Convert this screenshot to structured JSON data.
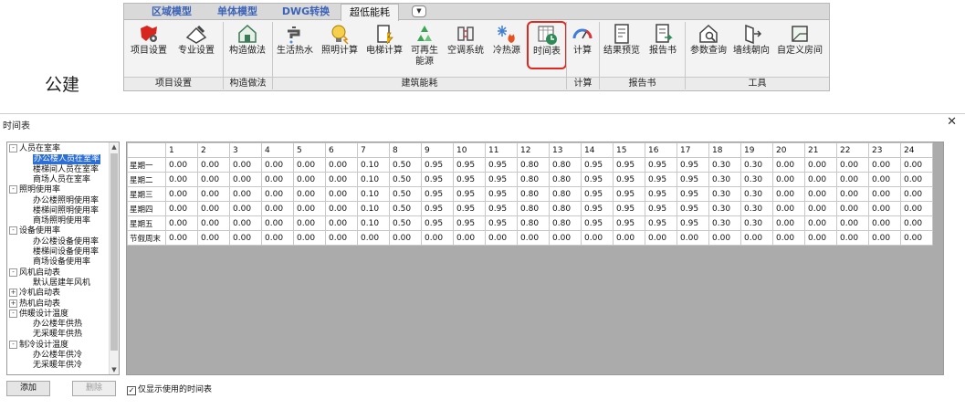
{
  "ribbon": {
    "tabs": [
      {
        "label": "区域模型",
        "active": false
      },
      {
        "label": "单体模型",
        "active": false
      },
      {
        "label": "DWG转换",
        "active": false
      },
      {
        "label": "超低能耗",
        "active": true
      }
    ],
    "tools": [
      {
        "label": "项目设置",
        "icon": "project-settings-icon"
      },
      {
        "label": "专业设置",
        "icon": "professional-settings-icon"
      },
      {
        "label": "构造做法",
        "icon": "house-construction-icon"
      },
      {
        "label": "生活热水",
        "icon": "hot-water-faucet-icon"
      },
      {
        "label": "照明计算",
        "icon": "lightbulb-icon"
      },
      {
        "label": "电梯计算",
        "icon": "elevator-icon"
      },
      {
        "label": "可再生\n能源",
        "icon": "recycle-icon"
      },
      {
        "label": "空调系统",
        "icon": "air-conditioning-icon"
      },
      {
        "label": "冷热源",
        "icon": "snow-flame-icon"
      },
      {
        "label": "时间表",
        "icon": "schedule-clock-icon"
      },
      {
        "label": "计算",
        "icon": "gauge-icon"
      },
      {
        "label": "结果预览",
        "icon": "result-preview-icon"
      },
      {
        "label": "报告书",
        "icon": "report-icon"
      },
      {
        "label": "参数查询",
        "icon": "parameter-query-icon"
      },
      {
        "label": "墙线朝向",
        "icon": "wall-orientation-icon"
      },
      {
        "label": "自定义房间",
        "icon": "custom-room-icon"
      }
    ],
    "groups": [
      "项目设置",
      "构造做法",
      "建筑能耗",
      "计算",
      "报告书",
      "工具"
    ]
  },
  "side_label": "公建",
  "dialog": {
    "title": "时间表",
    "tree": [
      {
        "label": "人员在室率",
        "level": 0,
        "expander": "-"
      },
      {
        "label": "办公楼人员在室率",
        "level": 1,
        "selected": true
      },
      {
        "label": "楼梯间人员在室率",
        "level": 1
      },
      {
        "label": "商场人员在室率",
        "level": 1
      },
      {
        "label": "照明使用率",
        "level": 0,
        "expander": "-"
      },
      {
        "label": "办公楼照明使用率",
        "level": 1
      },
      {
        "label": "楼梯间照明使用率",
        "level": 1
      },
      {
        "label": "商场照明使用率",
        "level": 1
      },
      {
        "label": "设备使用率",
        "level": 0,
        "expander": "-"
      },
      {
        "label": "办公楼设备使用率",
        "level": 1
      },
      {
        "label": "楼梯间设备使用率",
        "level": 1
      },
      {
        "label": "商场设备使用率",
        "level": 1
      },
      {
        "label": "风机启动表",
        "level": 0,
        "expander": "-"
      },
      {
        "label": "默认居建年风机",
        "level": 1
      },
      {
        "label": "冷机启动表",
        "level": 0,
        "expander": "+"
      },
      {
        "label": "热机启动表",
        "level": 0,
        "expander": "+"
      },
      {
        "label": "供暖设计温度",
        "level": 0,
        "expander": "-"
      },
      {
        "label": "办公楼年供热",
        "level": 1
      },
      {
        "label": "无采暖年供热",
        "level": 1
      },
      {
        "label": "制冷设计温度",
        "level": 0,
        "expander": "-"
      },
      {
        "label": "办公楼年供冷",
        "level": 1
      },
      {
        "label": "无采暖年供冷",
        "level": 1
      }
    ],
    "hours": [
      "1",
      "2",
      "3",
      "4",
      "5",
      "6",
      "7",
      "8",
      "9",
      "10",
      "11",
      "12",
      "13",
      "14",
      "15",
      "16",
      "17",
      "18",
      "19",
      "20",
      "21",
      "22",
      "23",
      "24"
    ],
    "rows": [
      {
        "label": "星期一",
        "values": [
          "0.00",
          "0.00",
          "0.00",
          "0.00",
          "0.00",
          "0.00",
          "0.10",
          "0.50",
          "0.95",
          "0.95",
          "0.95",
          "0.80",
          "0.80",
          "0.95",
          "0.95",
          "0.95",
          "0.95",
          "0.30",
          "0.30",
          "0.00",
          "0.00",
          "0.00",
          "0.00",
          "0.00"
        ]
      },
      {
        "label": "星期二",
        "values": [
          "0.00",
          "0.00",
          "0.00",
          "0.00",
          "0.00",
          "0.00",
          "0.10",
          "0.50",
          "0.95",
          "0.95",
          "0.95",
          "0.80",
          "0.80",
          "0.95",
          "0.95",
          "0.95",
          "0.95",
          "0.30",
          "0.30",
          "0.00",
          "0.00",
          "0.00",
          "0.00",
          "0.00"
        ]
      },
      {
        "label": "星期三",
        "values": [
          "0.00",
          "0.00",
          "0.00",
          "0.00",
          "0.00",
          "0.00",
          "0.10",
          "0.50",
          "0.95",
          "0.95",
          "0.95",
          "0.80",
          "0.80",
          "0.95",
          "0.95",
          "0.95",
          "0.95",
          "0.30",
          "0.30",
          "0.00",
          "0.00",
          "0.00",
          "0.00",
          "0.00"
        ]
      },
      {
        "label": "星期四",
        "values": [
          "0.00",
          "0.00",
          "0.00",
          "0.00",
          "0.00",
          "0.00",
          "0.10",
          "0.50",
          "0.95",
          "0.95",
          "0.95",
          "0.80",
          "0.80",
          "0.95",
          "0.95",
          "0.95",
          "0.95",
          "0.30",
          "0.30",
          "0.00",
          "0.00",
          "0.00",
          "0.00",
          "0.00"
        ]
      },
      {
        "label": "星期五",
        "values": [
          "0.00",
          "0.00",
          "0.00",
          "0.00",
          "0.00",
          "0.00",
          "0.10",
          "0.50",
          "0.95",
          "0.95",
          "0.95",
          "0.80",
          "0.80",
          "0.95",
          "0.95",
          "0.95",
          "0.95",
          "0.30",
          "0.30",
          "0.00",
          "0.00",
          "0.00",
          "0.00",
          "0.00"
        ]
      },
      {
        "label": "节假周末",
        "values": [
          "0.00",
          "0.00",
          "0.00",
          "0.00",
          "0.00",
          "0.00",
          "0.00",
          "0.00",
          "0.00",
          "0.00",
          "0.00",
          "0.00",
          "0.00",
          "0.00",
          "0.00",
          "0.00",
          "0.00",
          "0.00",
          "0.00",
          "0.00",
          "0.00",
          "0.00",
          "0.00",
          "0.00"
        ]
      }
    ],
    "add_label": "添加",
    "delete_label": "删除",
    "show_used_label": "仅显示使用的时间表",
    "show_used_checked": true,
    "close_symbol": "✕"
  },
  "colors": {
    "highlight": "#e0281e",
    "selection": "#2c6fd6",
    "tab_text": "#3b63b8"
  }
}
